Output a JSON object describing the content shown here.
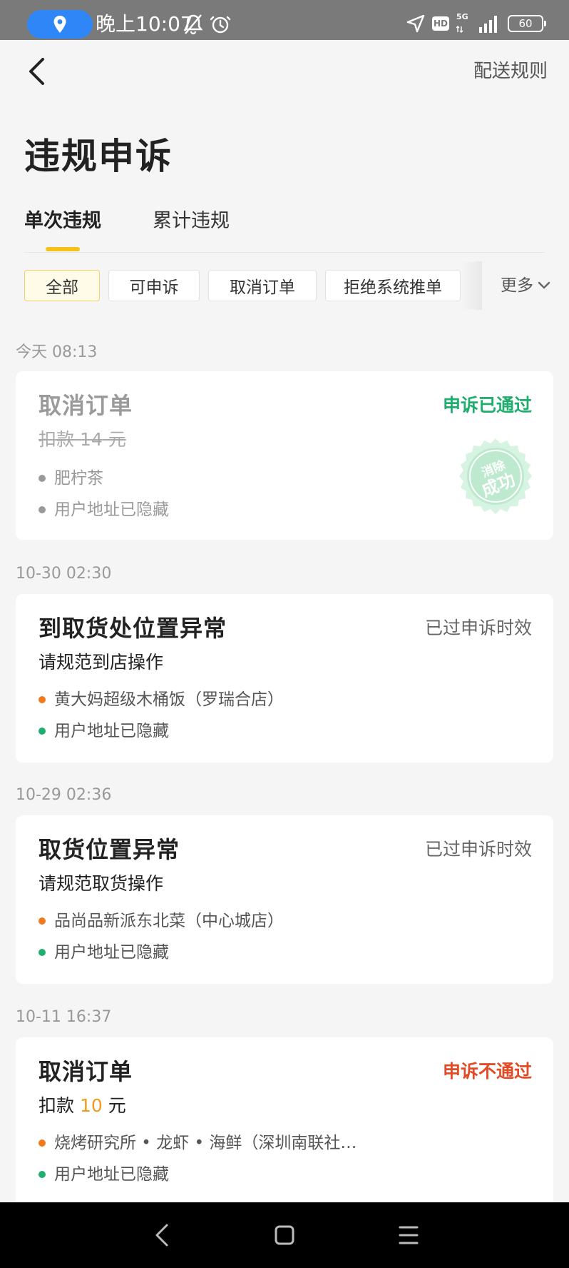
{
  "status_bar": {
    "time": "晚上10:07",
    "battery": "60",
    "network": "5G",
    "hd": "HD"
  },
  "header": {
    "rules_link": "配送规则",
    "title": "违规申诉"
  },
  "tabs": [
    {
      "label": "单次违规",
      "active": true
    },
    {
      "label": "累计违规",
      "active": false
    }
  ],
  "filters": [
    {
      "label": "全部",
      "active": true
    },
    {
      "label": "可申诉",
      "active": false
    },
    {
      "label": "取消订单",
      "active": false
    },
    {
      "label": "拒绝系统推单",
      "active": false
    }
  ],
  "more_label": "更多",
  "records": [
    {
      "time": "今天 08:13",
      "title": "取消订单",
      "status": "申诉已通过",
      "sub_prefix": "扣款 ",
      "sub_amount": "14",
      "sub_suffix": " 元",
      "store": "肥柠茶",
      "address": "用户地址已隐藏",
      "stamp_top": "消除",
      "stamp_bottom": "成功"
    },
    {
      "time": "10-30 02:30",
      "title": "到取货处位置异常",
      "status": "已过申诉时效",
      "sub": "请规范到店操作",
      "store": "黄大妈超级木桶饭（罗瑞合店）",
      "address": "用户地址已隐藏"
    },
    {
      "time": "10-29 02:36",
      "title": "取货位置异常",
      "status": "已过申诉时效",
      "sub": "请规范取货操作",
      "store": "品尚品新派东北菜（中心城店）",
      "address": "用户地址已隐藏"
    },
    {
      "time": "10-11 16:37",
      "title": "取消订单",
      "status": "申诉不通过",
      "sub_prefix": "扣款 ",
      "sub_amount": "10",
      "sub_suffix": " 元",
      "store": "烧烤研究所 • 龙虾 • 海鲜（深圳南联社…",
      "address": "用户地址已隐藏"
    }
  ]
}
